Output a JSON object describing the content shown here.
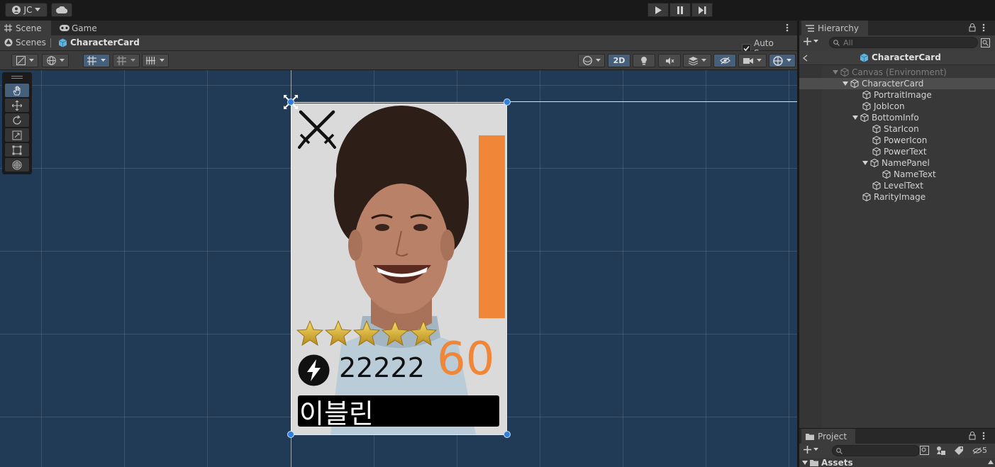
{
  "topbar": {
    "account_label": "JC",
    "icons": [
      "account-icon",
      "cloud-icon",
      "play-icon",
      "pause-icon",
      "step-icon"
    ]
  },
  "scene_panel": {
    "tabs": [
      {
        "label": "Scene",
        "icon": "grid-icon",
        "active": true
      },
      {
        "label": "Game",
        "icon": "gamepad-icon",
        "active": false
      }
    ],
    "breadcrumb": [
      "Scenes",
      "CharacterCard"
    ],
    "auto_save_label": "Auto Save",
    "auto_save_checked": true,
    "toolbar": {
      "mode_2d_label": "2D"
    }
  },
  "card": {
    "power_value": "22222",
    "level_value": "60",
    "name_value": "이블린",
    "stars": 5,
    "colors": {
      "accent": "#ef8638",
      "background": "#213a56"
    }
  },
  "hierarchy": {
    "title": "Hierarchy",
    "search_placeholder": "All",
    "root": "CharacterCard",
    "items": [
      {
        "label": "Canvas (Environment)",
        "depth": 0,
        "expanded": true,
        "dim": true
      },
      {
        "label": "CharacterCard",
        "depth": 1,
        "expanded": true,
        "selected": true
      },
      {
        "label": "PortraitImage",
        "depth": 2
      },
      {
        "label": "JobIcon",
        "depth": 2
      },
      {
        "label": "BottomInfo",
        "depth": 2,
        "expanded": true
      },
      {
        "label": "StarIcon",
        "depth": 3
      },
      {
        "label": "PowerIcon",
        "depth": 3
      },
      {
        "label": "PowerText",
        "depth": 3
      },
      {
        "label": "NamePanel",
        "depth": 3,
        "expanded": true
      },
      {
        "label": "NameText",
        "depth": 4
      },
      {
        "label": "LevelText",
        "depth": 3
      },
      {
        "label": "RarityImage",
        "depth": 2
      }
    ]
  },
  "project": {
    "title": "Project",
    "hidden_count": "5",
    "root_folder": "Assets"
  }
}
